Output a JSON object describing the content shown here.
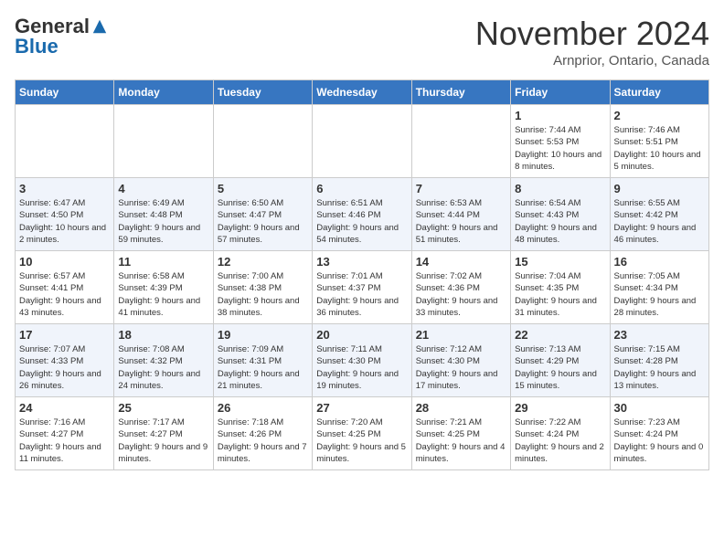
{
  "logo": {
    "general": "General",
    "blue": "Blue"
  },
  "title": "November 2024",
  "subtitle": "Arnprior, Ontario, Canada",
  "days_of_week": [
    "Sunday",
    "Monday",
    "Tuesday",
    "Wednesday",
    "Thursday",
    "Friday",
    "Saturday"
  ],
  "weeks": [
    [
      {
        "day": "",
        "info": ""
      },
      {
        "day": "",
        "info": ""
      },
      {
        "day": "",
        "info": ""
      },
      {
        "day": "",
        "info": ""
      },
      {
        "day": "",
        "info": ""
      },
      {
        "day": "1",
        "info": "Sunrise: 7:44 AM\nSunset: 5:53 PM\nDaylight: 10 hours\nand 8 minutes."
      },
      {
        "day": "2",
        "info": "Sunrise: 7:46 AM\nSunset: 5:51 PM\nDaylight: 10 hours\nand 5 minutes."
      }
    ],
    [
      {
        "day": "3",
        "info": "Sunrise: 6:47 AM\nSunset: 4:50 PM\nDaylight: 10 hours\nand 2 minutes."
      },
      {
        "day": "4",
        "info": "Sunrise: 6:49 AM\nSunset: 4:48 PM\nDaylight: 9 hours\nand 59 minutes."
      },
      {
        "day": "5",
        "info": "Sunrise: 6:50 AM\nSunset: 4:47 PM\nDaylight: 9 hours\nand 57 minutes."
      },
      {
        "day": "6",
        "info": "Sunrise: 6:51 AM\nSunset: 4:46 PM\nDaylight: 9 hours\nand 54 minutes."
      },
      {
        "day": "7",
        "info": "Sunrise: 6:53 AM\nSunset: 4:44 PM\nDaylight: 9 hours\nand 51 minutes."
      },
      {
        "day": "8",
        "info": "Sunrise: 6:54 AM\nSunset: 4:43 PM\nDaylight: 9 hours\nand 48 minutes."
      },
      {
        "day": "9",
        "info": "Sunrise: 6:55 AM\nSunset: 4:42 PM\nDaylight: 9 hours\nand 46 minutes."
      }
    ],
    [
      {
        "day": "10",
        "info": "Sunrise: 6:57 AM\nSunset: 4:41 PM\nDaylight: 9 hours\nand 43 minutes."
      },
      {
        "day": "11",
        "info": "Sunrise: 6:58 AM\nSunset: 4:39 PM\nDaylight: 9 hours\nand 41 minutes."
      },
      {
        "day": "12",
        "info": "Sunrise: 7:00 AM\nSunset: 4:38 PM\nDaylight: 9 hours\nand 38 minutes."
      },
      {
        "day": "13",
        "info": "Sunrise: 7:01 AM\nSunset: 4:37 PM\nDaylight: 9 hours\nand 36 minutes."
      },
      {
        "day": "14",
        "info": "Sunrise: 7:02 AM\nSunset: 4:36 PM\nDaylight: 9 hours\nand 33 minutes."
      },
      {
        "day": "15",
        "info": "Sunrise: 7:04 AM\nSunset: 4:35 PM\nDaylight: 9 hours\nand 31 minutes."
      },
      {
        "day": "16",
        "info": "Sunrise: 7:05 AM\nSunset: 4:34 PM\nDaylight: 9 hours\nand 28 minutes."
      }
    ],
    [
      {
        "day": "17",
        "info": "Sunrise: 7:07 AM\nSunset: 4:33 PM\nDaylight: 9 hours\nand 26 minutes."
      },
      {
        "day": "18",
        "info": "Sunrise: 7:08 AM\nSunset: 4:32 PM\nDaylight: 9 hours\nand 24 minutes."
      },
      {
        "day": "19",
        "info": "Sunrise: 7:09 AM\nSunset: 4:31 PM\nDaylight: 9 hours\nand 21 minutes."
      },
      {
        "day": "20",
        "info": "Sunrise: 7:11 AM\nSunset: 4:30 PM\nDaylight: 9 hours\nand 19 minutes."
      },
      {
        "day": "21",
        "info": "Sunrise: 7:12 AM\nSunset: 4:30 PM\nDaylight: 9 hours\nand 17 minutes."
      },
      {
        "day": "22",
        "info": "Sunrise: 7:13 AM\nSunset: 4:29 PM\nDaylight: 9 hours\nand 15 minutes."
      },
      {
        "day": "23",
        "info": "Sunrise: 7:15 AM\nSunset: 4:28 PM\nDaylight: 9 hours\nand 13 minutes."
      }
    ],
    [
      {
        "day": "24",
        "info": "Sunrise: 7:16 AM\nSunset: 4:27 PM\nDaylight: 9 hours\nand 11 minutes."
      },
      {
        "day": "25",
        "info": "Sunrise: 7:17 AM\nSunset: 4:27 PM\nDaylight: 9 hours\nand 9 minutes."
      },
      {
        "day": "26",
        "info": "Sunrise: 7:18 AM\nSunset: 4:26 PM\nDaylight: 9 hours\nand 7 minutes."
      },
      {
        "day": "27",
        "info": "Sunrise: 7:20 AM\nSunset: 4:25 PM\nDaylight: 9 hours\nand 5 minutes."
      },
      {
        "day": "28",
        "info": "Sunrise: 7:21 AM\nSunset: 4:25 PM\nDaylight: 9 hours\nand 4 minutes."
      },
      {
        "day": "29",
        "info": "Sunrise: 7:22 AM\nSunset: 4:24 PM\nDaylight: 9 hours\nand 2 minutes."
      },
      {
        "day": "30",
        "info": "Sunrise: 7:23 AM\nSunset: 4:24 PM\nDaylight: 9 hours\nand 0 minutes."
      }
    ]
  ]
}
